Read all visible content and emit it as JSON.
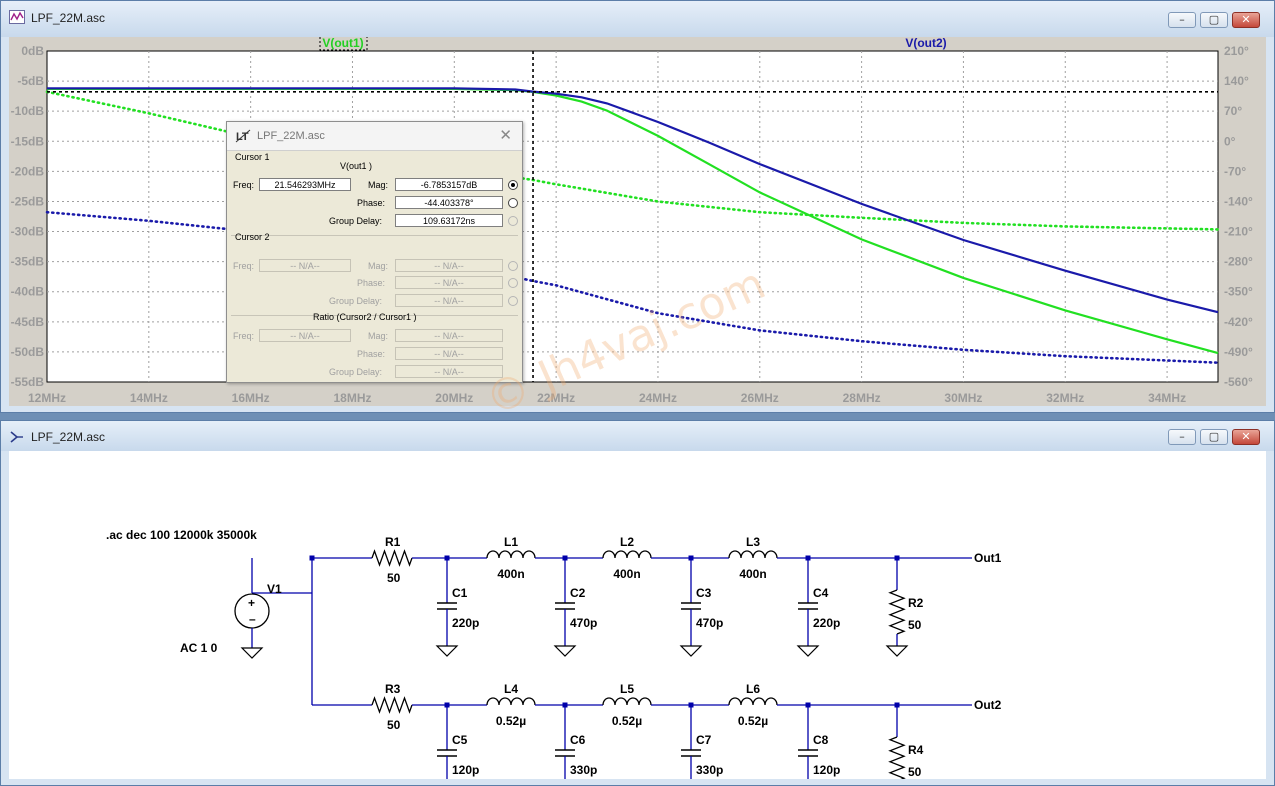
{
  "plot_window": {
    "title": "LPF_22M.asc",
    "trace_labels": [
      "V(out1)",
      "V(out2)"
    ],
    "buttons": [
      "minimize",
      "maximize",
      "close"
    ]
  },
  "chart_data": {
    "type": "line",
    "x_ticks": [
      "12MHz",
      "14MHz",
      "16MHz",
      "18MHz",
      "20MHz",
      "22MHz",
      "24MHz",
      "26MHz",
      "28MHz",
      "30MHz",
      "32MHz",
      "34MHz"
    ],
    "y_left_ticks": [
      "0dB",
      "-5dB",
      "-10dB",
      "-15dB",
      "-20dB",
      "-25dB",
      "-30dB",
      "-35dB",
      "-40dB",
      "-45dB",
      "-50dB",
      "-55dB"
    ],
    "y_right_ticks": [
      "210°",
      "140°",
      "70°",
      "0°",
      "-70°",
      "-140°",
      "-210°",
      "-280°",
      "-350°",
      "-420°",
      "-490°",
      "-560°"
    ],
    "xlim": [
      12,
      35
    ],
    "ylim_db": [
      -55,
      0
    ],
    "ylim_phase": [
      -560,
      210
    ],
    "grid": true,
    "series": [
      {
        "name": "V(out1)",
        "kind": "magnitude",
        "color": "#22e022",
        "x": [
          12,
          16,
          20,
          21.2,
          21.546,
          22,
          22.5,
          23,
          24,
          25,
          26,
          28,
          30,
          32,
          34,
          35
        ],
        "y": [
          -6.3,
          -6.3,
          -6.3,
          -6.5,
          -6.8,
          -7.4,
          -8.4,
          -9.9,
          -14.1,
          -18.8,
          -23.5,
          -31.3,
          -37.7,
          -43.1,
          -47.9,
          -50.2
        ]
      },
      {
        "name": "V(out1)",
        "kind": "phase",
        "color": "#22e022",
        "x": [
          12,
          14,
          16,
          18,
          19,
          20,
          21,
          21.546,
          22,
          24,
          26,
          28,
          30,
          32,
          35
        ],
        "y": [
          115,
          65,
          10,
          -30,
          -50,
          -65,
          -80,
          -90,
          -100,
          -140,
          -165,
          -178,
          -190,
          -198,
          -205
        ]
      },
      {
        "name": "V(out2)",
        "kind": "magnitude",
        "color": "#1a1aaa",
        "x": [
          12,
          16,
          20,
          21.2,
          21.546,
          22,
          22.5,
          23,
          24,
          25,
          26,
          28,
          30,
          32,
          34,
          35
        ],
        "y": [
          -6.2,
          -6.2,
          -6.2,
          -6.4,
          -6.75,
          -7.1,
          -7.7,
          -8.7,
          -11.8,
          -15.2,
          -18.8,
          -25.4,
          -31.4,
          -36.5,
          -41.3,
          -43.4
        ]
      },
      {
        "name": "V(out2)",
        "kind": "phase",
        "color": "#1a1aaa",
        "x": [
          12,
          14,
          16,
          18,
          20,
          21.546,
          22,
          24,
          26,
          28,
          30,
          32,
          34,
          35
        ],
        "y": [
          -165,
          -185,
          -210,
          -240,
          -285,
          -325,
          -335,
          -400,
          -440,
          -465,
          -485,
          -500,
          -510,
          -515
        ]
      }
    ],
    "cursor": {
      "x": 21.546293,
      "y_db": -6.7853157
    }
  },
  "cursor_dialog": {
    "title": "LPF_22M.asc",
    "cursor1_label": "Cursor 1",
    "cursor1_trace": "V(out1 )",
    "freq_label": "Freq:",
    "freq_value": "21.546293MHz",
    "mag_label": "Mag:",
    "mag_value": "-6.7853157dB",
    "phase_label": "Phase:",
    "phase_value": "-44.403378°",
    "gd_label": "Group Delay:",
    "gd_value": "109.63172ns",
    "cursor2_label": "Cursor 2",
    "na": "-- N/A--",
    "ratio_label": "Ratio (Cursor2 / Cursor1 )"
  },
  "schematic_window": {
    "title": "LPF_22M.asc",
    "directive": ".ac dec 100 12000k 35000k",
    "source": {
      "name": "V1",
      "value": "AC 1 0"
    },
    "top_chain": {
      "R": {
        "name": "R1",
        "value": "50"
      },
      "inductors": [
        {
          "name": "L1",
          "value": "400n"
        },
        {
          "name": "L2",
          "value": "400n"
        },
        {
          "name": "L3",
          "value": "400n"
        }
      ],
      "caps": [
        {
          "name": "C1",
          "value": "220p"
        },
        {
          "name": "C2",
          "value": "470p"
        },
        {
          "name": "C3",
          "value": "470p"
        },
        {
          "name": "C4",
          "value": "220p"
        }
      ],
      "load": {
        "name": "R2",
        "value": "50"
      },
      "out": "Out1"
    },
    "bottom_chain": {
      "R": {
        "name": "R3",
        "value": "50"
      },
      "inductors": [
        {
          "name": "L4",
          "value": "0.52µ"
        },
        {
          "name": "L5",
          "value": "0.52µ"
        },
        {
          "name": "L6",
          "value": "0.52µ"
        }
      ],
      "caps": [
        {
          "name": "C5",
          "value": "120p"
        },
        {
          "name": "C6",
          "value": "330p"
        },
        {
          "name": "C7",
          "value": "330p"
        },
        {
          "name": "C8",
          "value": "120p"
        }
      ],
      "load": {
        "name": "R4",
        "value": "50"
      },
      "out": "Out2"
    }
  },
  "watermark": "© Jh4vaj.com",
  "colors": {
    "out1": "#22e022",
    "out2": "#1a1aaa",
    "wire": "#0000aa"
  }
}
